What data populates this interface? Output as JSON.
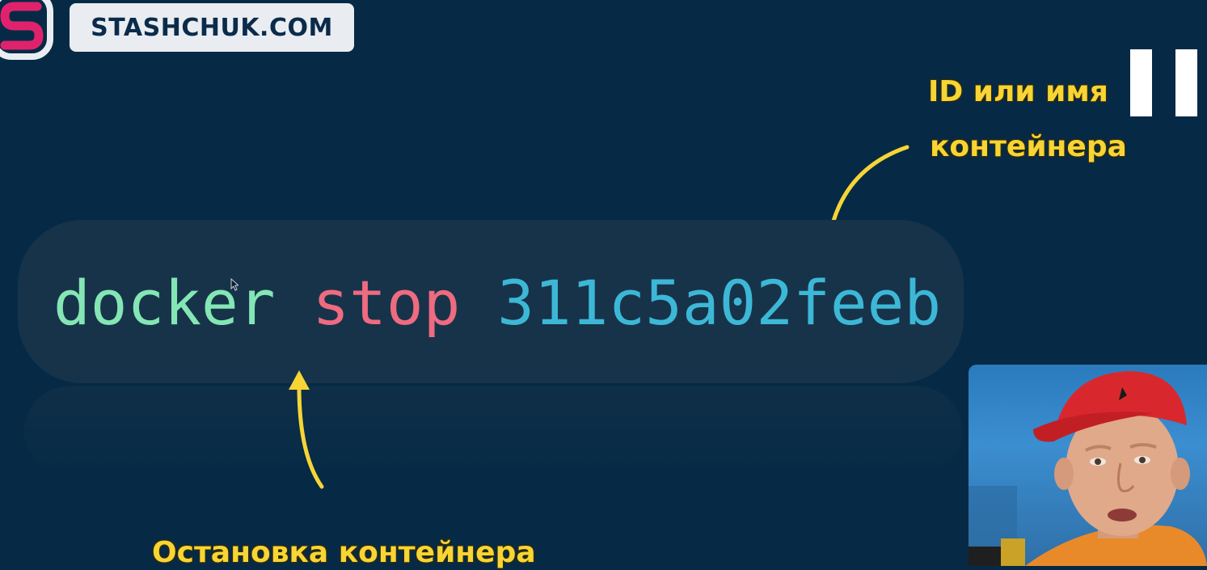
{
  "brand": {
    "name": "STASHCHUK.COM",
    "logo_letter": "S"
  },
  "command": {
    "cmd": "docker",
    "subcommand": "stop",
    "container_id": "311c5a02feeb"
  },
  "annotations": {
    "top_right_line1": "ID или имя",
    "top_right_line2": "контейнера",
    "bottom": "Остановка контейнера"
  },
  "icons": [
    "logo-s-icon",
    "pause-icon",
    "mouse-cursor-icon",
    "arrow-icon"
  ],
  "colors": {
    "background": "#062a46",
    "command_box": "#17334a",
    "cmd": "#84e6b4",
    "subcommand": "#ee6b80",
    "container_id": "#3cb8d6",
    "annotation": "#f6d535",
    "logo_accent": "#e0226c"
  }
}
